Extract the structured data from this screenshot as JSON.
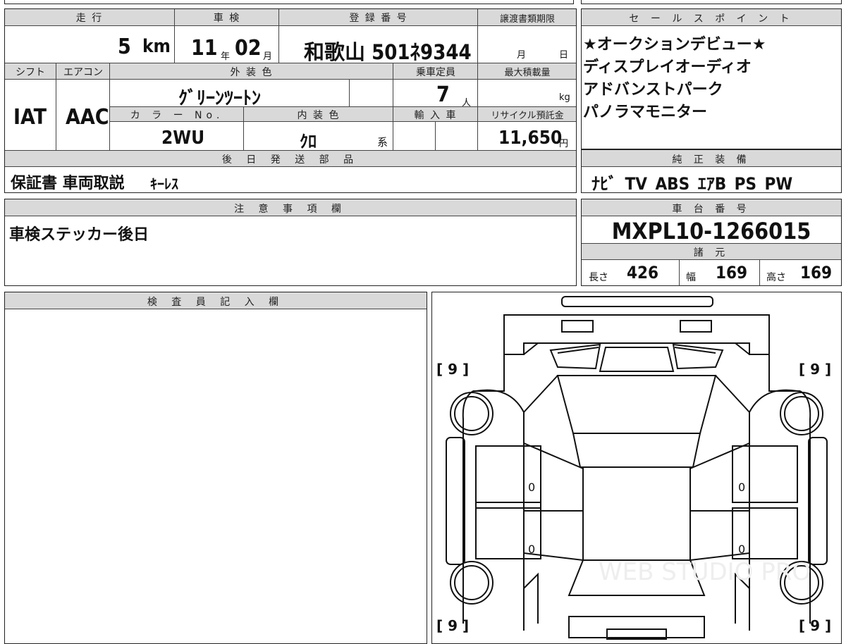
{
  "top": {
    "mileage_label": "走 行",
    "mileage_value": "5",
    "mileage_unit": "km",
    "shaken_label": "車 検",
    "shaken_year": "11",
    "shaken_year_unit": "年",
    "shaken_month": "02",
    "shaken_month_unit": "月",
    "reg_label": "登 録 番 号",
    "reg_value": "和歌山 501ﾈ9344",
    "transfer_label": "譲渡書類期限",
    "transfer_month_unit": "月",
    "transfer_day_unit": "日"
  },
  "mid": {
    "shift_label": "シフト",
    "shift_value": "IAT",
    "ac_label": "エアコン",
    "ac_value": "AAC",
    "exterior_label": "外 装 色",
    "exterior_value": "ｸﾞﾘｰﾝﾂｰﾄﾝ",
    "capacity_label": "乗車定員",
    "capacity_value": "7",
    "capacity_unit": "人",
    "load_label": "最大積載量",
    "load_unit": "kg",
    "color_no_label": "カ ラ ー No.",
    "color_no_value": "2WU",
    "interior_label": "内 装 色",
    "interior_value": "ｸﾛ",
    "interior_suffix": "系",
    "import_label": "輸 入 車",
    "recycle_label": "リサイクル預託金",
    "recycle_value": "11,650",
    "recycle_unit": "円"
  },
  "later_parts": {
    "label": "後 日 発 送 部 品",
    "value_main": "保証書 車両取説",
    "value_sub": "ｷｰﾚｽ"
  },
  "sales_points": {
    "label": "セ ー ル ス ポ イ ン ト",
    "lines": [
      "★オークションデビュー★",
      "ディスプレイオーディオ",
      "アドバンストパーク",
      "パノラマモニター"
    ]
  },
  "equipment": {
    "label": "純 正 装 備",
    "value": "ﾅﾋﾞ TV ABS ｴｱB PS PW"
  },
  "notes": {
    "label": "注 意 事 項 欄",
    "value": "車検ステッカー後日"
  },
  "chassis": {
    "label": "車 台 番 号",
    "value": "MXPL10-1266015",
    "spec_label": "諸 元",
    "length_label": "長さ",
    "length_value": "426",
    "width_label": "幅",
    "width_value": "169",
    "height_label": "高さ",
    "height_value": "169"
  },
  "inspector": {
    "label": "検 査 員 記 入 欄"
  },
  "diagram": {
    "tire_front_left": "[ 9 ]",
    "tire_front_right": "[ 9 ]",
    "tire_rear_left": "[ 9 ]",
    "tire_rear_right": "[ 9 ]",
    "door_fl": "0",
    "door_fr": "0",
    "door_rl": "0",
    "door_rr": "0",
    "watermark": "WEB STUDIO PRO"
  }
}
